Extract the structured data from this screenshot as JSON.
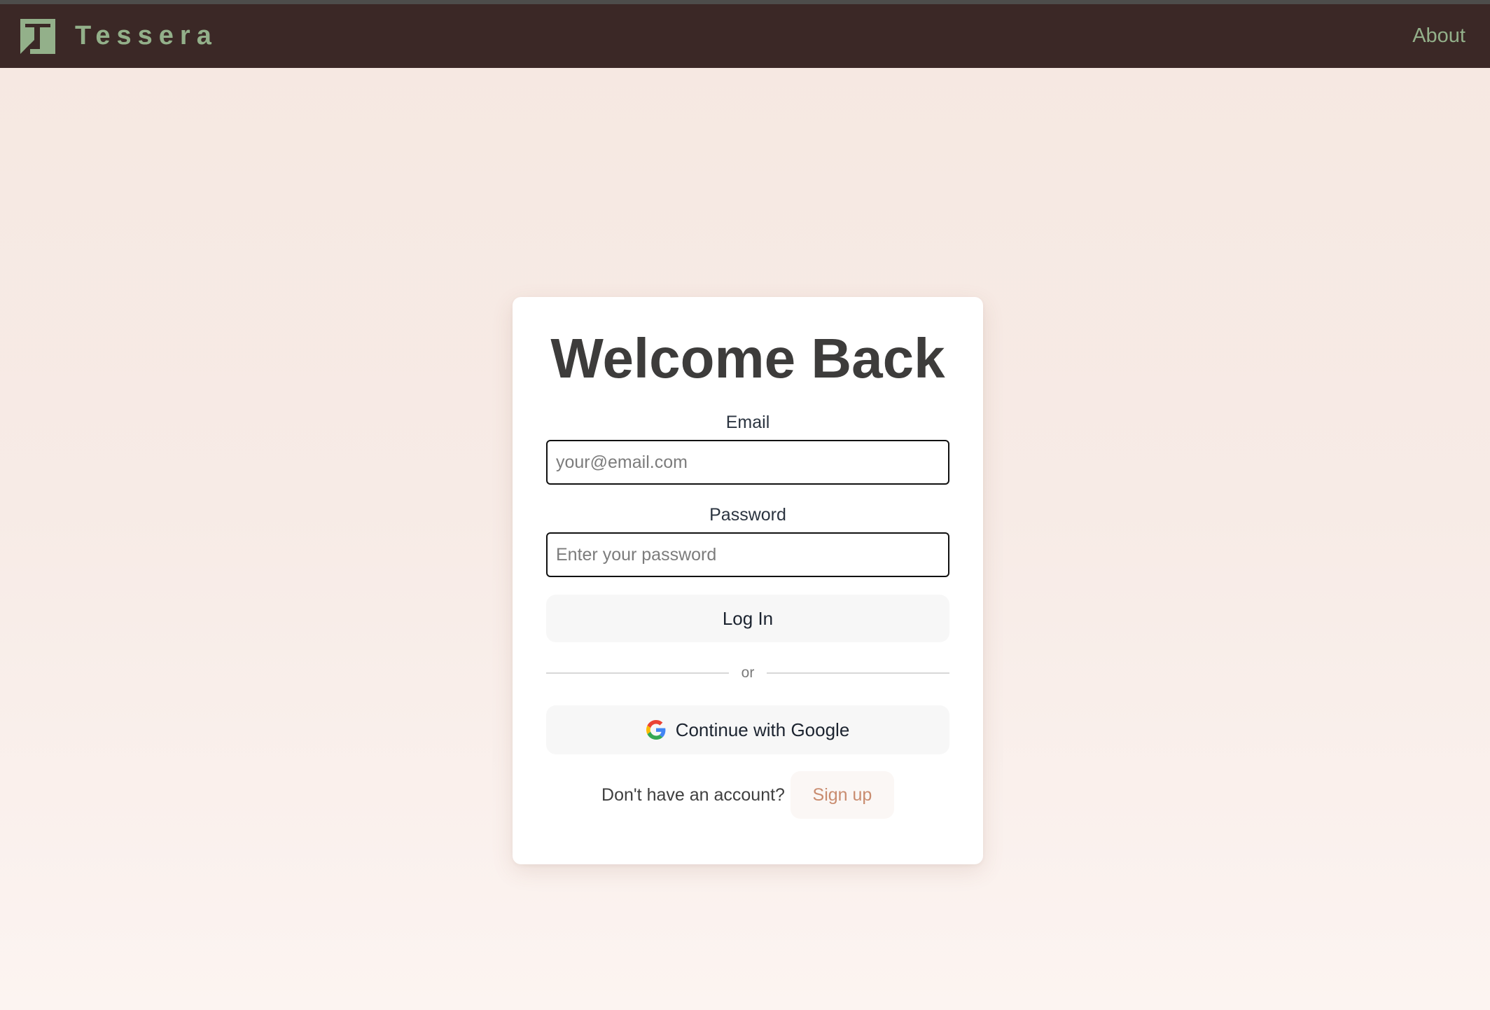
{
  "app": {
    "brand_name": "Tessera",
    "logo_icon": "tessera-logo-icon"
  },
  "navbar": {
    "about_link": "About"
  },
  "login_card": {
    "title": "Welcome Back",
    "email_label": "Email",
    "email_value": "",
    "email_placeholder": "your@email.com",
    "password_label": "Password",
    "password_value": "",
    "password_placeholder": "Enter your password",
    "login_button": "Log In",
    "divider_text": "or",
    "google_button": "Continue with Google",
    "google_icon": "google-icon",
    "signup_prompt": "Don't have an account?",
    "signup_button": "Sign up"
  },
  "colors": {
    "navbar_bg": "#3b2826",
    "brand_green": "#93b08a",
    "page_bg_top": "#f6e8e1",
    "page_bg_bottom": "#fcf4f1",
    "card_bg": "#ffffff",
    "signup_accent": "#c98c6f",
    "button_bg": "#f7f7f7",
    "title_text": "#3d3c3b"
  }
}
